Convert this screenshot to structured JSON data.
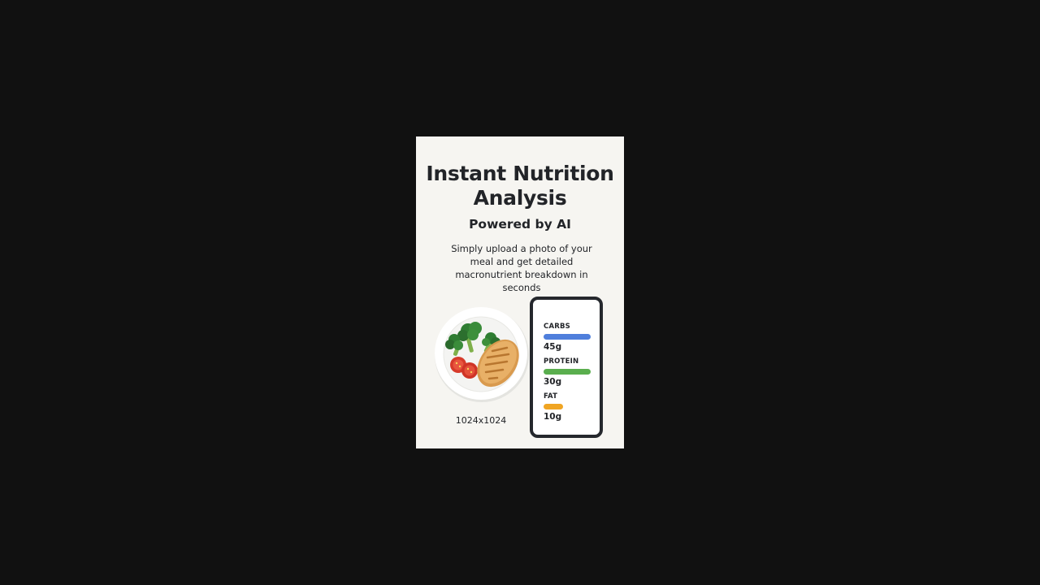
{
  "hero": {
    "title": "Instant Nutrition Analysis",
    "subtitle": "Powered by AI",
    "description": "Simply upload a photo of your meal and get detailed macronutrient breakdown in seconds"
  },
  "image_caption": "1024x1024",
  "macros": [
    {
      "label": "CARBS",
      "value": "45g",
      "level": 1.0,
      "color": "#4f7fdc"
    },
    {
      "label": "PROTEIN",
      "value": "30g",
      "level": 1.0,
      "color": "#5aae4e"
    },
    {
      "label": "FAT",
      "value": "10g",
      "level": 0.42,
      "color": "#f0a523"
    }
  ],
  "icons": {
    "plate": "meal-plate-illustration",
    "phone": "phone-frame"
  }
}
